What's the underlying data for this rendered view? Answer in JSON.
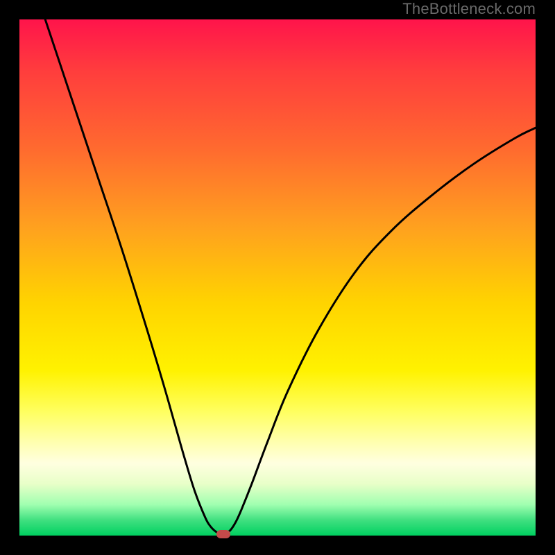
{
  "watermark": "TheBottleneck.com",
  "chart_data": {
    "type": "line",
    "title": "",
    "xlabel": "",
    "ylabel": "",
    "xlim": [
      0,
      100
    ],
    "ylim": [
      0,
      100
    ],
    "series": [
      {
        "name": "curve-left",
        "x": [
          5,
          10,
          15,
          20,
          25,
          28,
          30,
          32,
          34,
          36,
          37,
          38,
          39
        ],
        "y": [
          100,
          85,
          70,
          55,
          39,
          29,
          22,
          15,
          8.5,
          3.5,
          1.8,
          0.8,
          0.3
        ]
      },
      {
        "name": "curve-right",
        "x": [
          40,
          41,
          42,
          43,
          45,
          48,
          52,
          58,
          65,
          72,
          80,
          88,
          96,
          100
        ],
        "y": [
          0.3,
          1.2,
          2.8,
          5,
          10,
          18,
          28,
          40,
          51,
          59,
          66,
          72,
          77,
          79
        ]
      }
    ],
    "marker": {
      "x": 39.5,
      "y": 0.3,
      "color": "#c44a4a"
    },
    "gradient_stops": [
      {
        "pos": 0,
        "color": "#ff144b"
      },
      {
        "pos": 10,
        "color": "#ff3d3d"
      },
      {
        "pos": 25,
        "color": "#ff6a2f"
      },
      {
        "pos": 40,
        "color": "#ffa01f"
      },
      {
        "pos": 55,
        "color": "#ffd400"
      },
      {
        "pos": 68,
        "color": "#fff200"
      },
      {
        "pos": 76,
        "color": "#ffff60"
      },
      {
        "pos": 82,
        "color": "#ffffb0"
      },
      {
        "pos": 86,
        "color": "#ffffe0"
      },
      {
        "pos": 90,
        "color": "#e8ffc8"
      },
      {
        "pos": 94,
        "color": "#a0ffb0"
      },
      {
        "pos": 97,
        "color": "#40e080"
      },
      {
        "pos": 100,
        "color": "#00d060"
      }
    ]
  }
}
